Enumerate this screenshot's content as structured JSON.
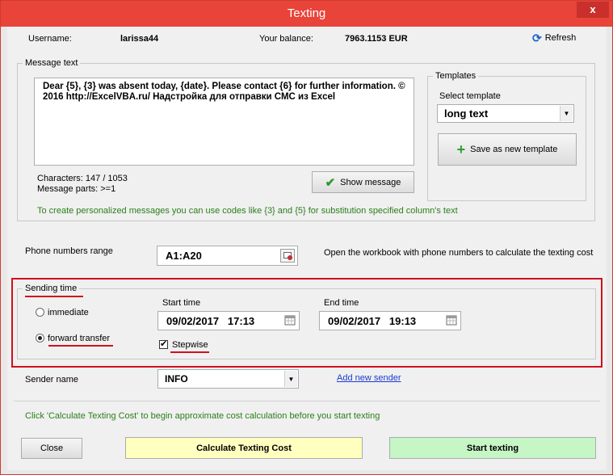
{
  "window": {
    "title": "Texting",
    "close_glyph": "x"
  },
  "header": {
    "username_label": "Username:",
    "username_value": "larissa44",
    "balance_label": "Your balance:",
    "balance_value": "7963.1153 EUR",
    "refresh_label": "Refresh"
  },
  "message": {
    "group_label": "Message text",
    "text": "Dear {5}, {3} was absent today, {date}. Please contact {6} for further information. © 2016 http://ExcelVBA.ru/ Надстройка для отправки СМС из Excel",
    "characters": "Characters: 147 / 1053",
    "parts": "Message parts: >=1",
    "show_button": "Show message",
    "hint": "To create personalized messages you can use codes like {3} and {5} for substitution specified column's text"
  },
  "templates": {
    "group_label": "Templates",
    "select_label": "Select template",
    "selected": "long text",
    "save_button": "Save as new template"
  },
  "phone": {
    "label": "Phone numbers range",
    "value": "A1:A20",
    "hint": "Open the workbook with phone numbers to calculate the texting cost"
  },
  "sending": {
    "group_label": "Sending time",
    "immediate_label": "immediate",
    "forward_label": "forward transfer",
    "start_label": "Start time",
    "start_value": "09/02/2017   17:13",
    "end_label": "End time",
    "end_value": "09/02/2017   19:13",
    "stepwise_label": "Stepwise",
    "check_glyph": "✔"
  },
  "sender": {
    "label": "Sender name",
    "value": "INFO",
    "add_link": "Add new sender"
  },
  "footer": {
    "hint": "Click 'Calculate Texting Cost' to begin approximate cost calculation before you start texting",
    "close_button": "Close",
    "calculate_button": "Calculate Texting Cost",
    "start_button": "Start texting"
  },
  "colors": {
    "title_bar": "#e8443a",
    "highlight": "#d0101e",
    "calc_button": "#ffffc0",
    "start_button": "#c6f5c6",
    "hint_text": "#2a7e1a"
  }
}
